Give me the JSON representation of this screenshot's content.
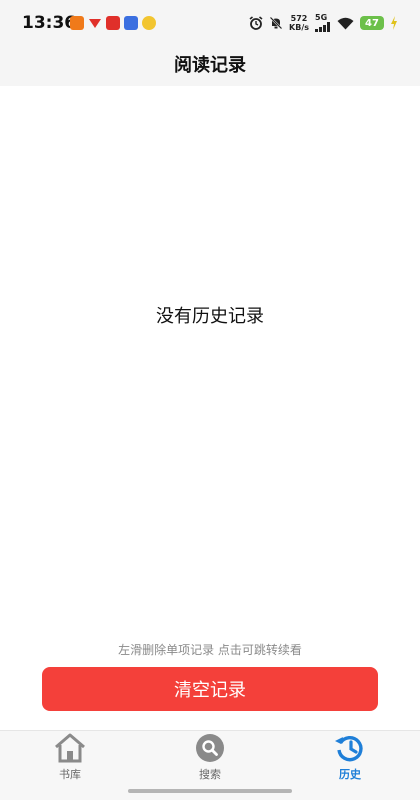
{
  "status_bar": {
    "time": "13:36",
    "net_speed_value": "572",
    "net_speed_unit": "KB/s",
    "network": "5G",
    "battery": "47"
  },
  "header": {
    "title": "阅读记录"
  },
  "main": {
    "empty_message": "没有历史记录",
    "hint": "左滑删除单项记录 点击可跳转续看",
    "clear_button": "清空记录"
  },
  "bottom_nav": {
    "items": [
      {
        "label": "书库",
        "icon": "home-icon",
        "active": false
      },
      {
        "label": "搜索",
        "icon": "search-icon",
        "active": false
      },
      {
        "label": "历史",
        "icon": "history-icon",
        "active": true
      }
    ]
  },
  "colors": {
    "accent": "#f4403a",
    "active_tab": "#1f7fd8",
    "battery": "#6cc04a"
  }
}
